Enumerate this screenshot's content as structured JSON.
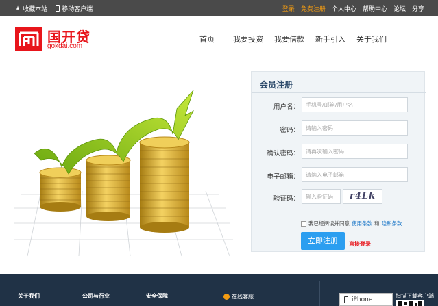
{
  "topbar": {
    "favorite": "收藏本站",
    "mobile_client": "移动客户端",
    "login": "登录",
    "register": "免费注册",
    "user_center": "个人中心",
    "help_center": "帮助中心",
    "forum": "论坛",
    "share": "分享"
  },
  "logo": {
    "name": "国开贷",
    "domain": "gokdai.com",
    "mark": "KP"
  },
  "nav": {
    "items": [
      "首页",
      "我要投资",
      "我要借款",
      "新手引入",
      "关于我们"
    ]
  },
  "register_form": {
    "title": "会员注册",
    "username_label": "用户名：",
    "username_placeholder": "手机号/邮箱/用户名",
    "password_label": "密码：",
    "password_placeholder": "请输入密码",
    "confirm_label": "确认密码：",
    "confirm_placeholder": "请再次输入密码",
    "email_label": "电子邮箱：",
    "email_placeholder": "请输入电子邮箱",
    "captcha_label": "验证码：",
    "captcha_placeholder": "输入验证码",
    "captcha_image_text": "r4Lk",
    "agree_prefix": "我已经阅读并同意",
    "terms_link": "使用条款",
    "and": "和",
    "privacy_link": "隐私条款",
    "submit": "立即注册",
    "direct_login": "直接登录"
  },
  "footer": {
    "about": "关于我们",
    "company": "公司与行业",
    "security": "安全保障",
    "online_service": "在线客服",
    "iphone": "iPhone",
    "qr_label": "扫描下载客户端"
  },
  "colors": {
    "brand_red": "#e8151b",
    "topbar_bg": "#4a4a4a",
    "accent_orange": "#f39c12",
    "button_blue": "#2b9ef0",
    "footer_bg": "#203246"
  }
}
